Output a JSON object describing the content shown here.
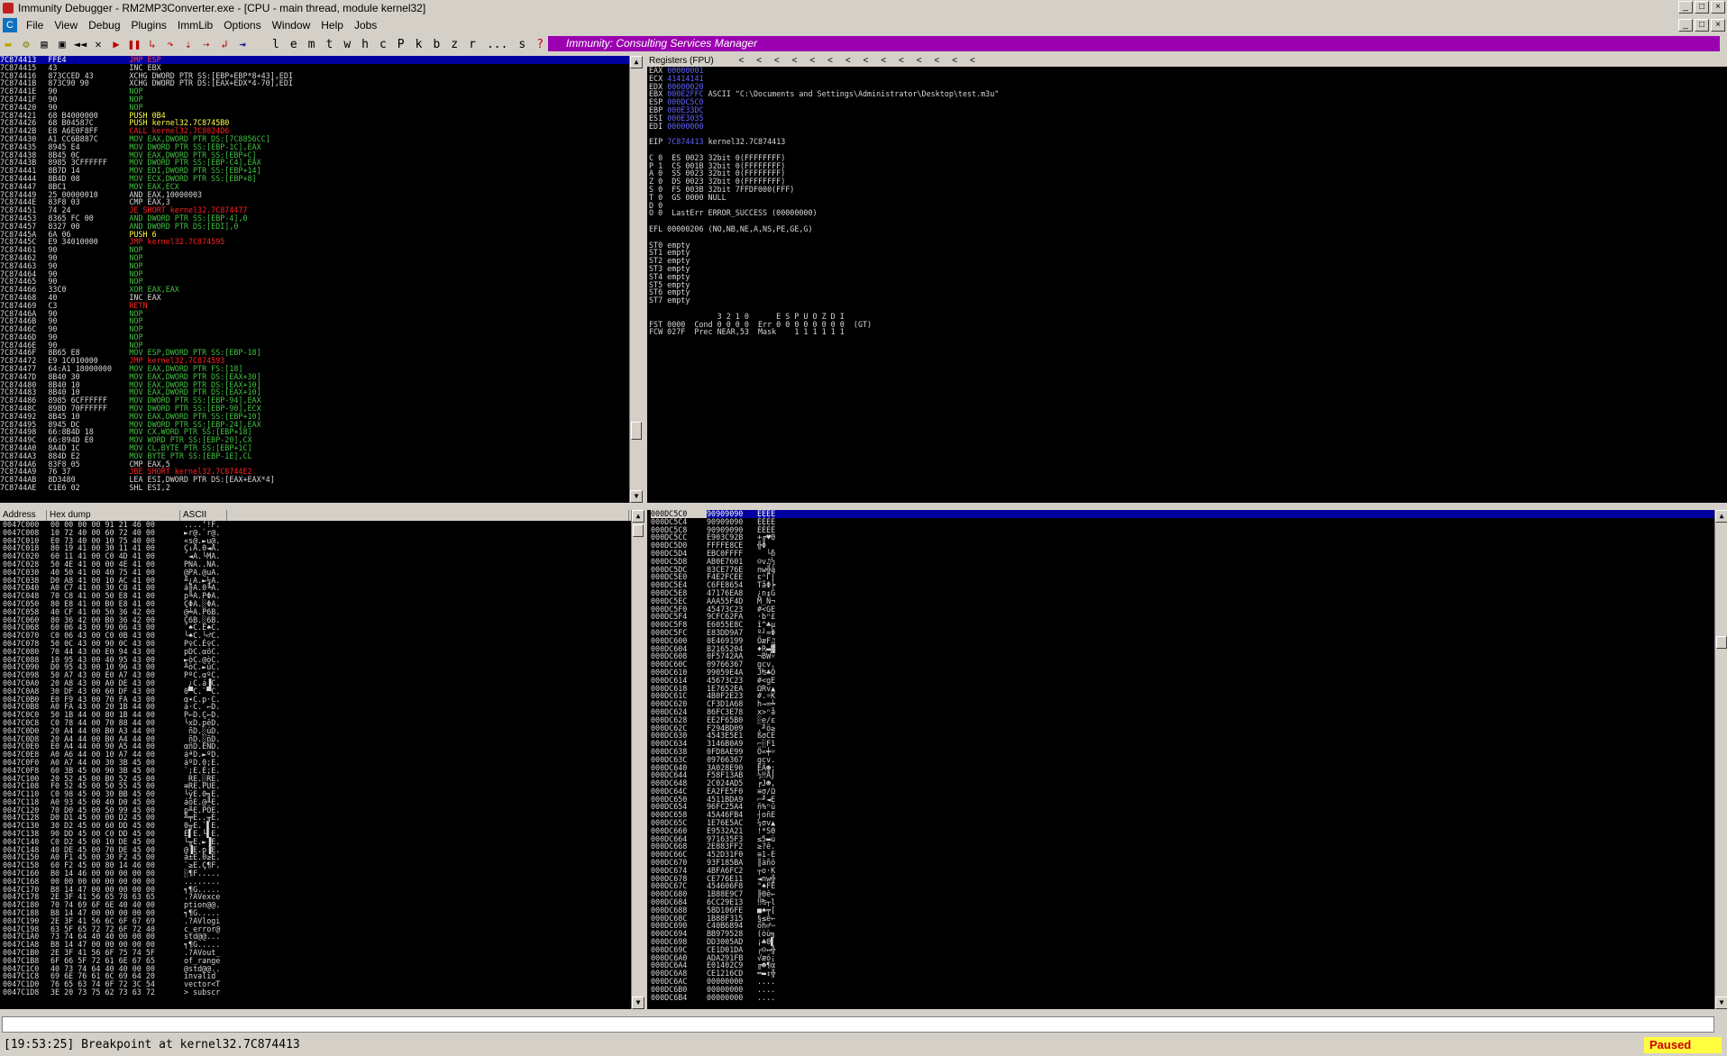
{
  "window": {
    "title": "Immunity Debugger - RM2MP3Converter.exe - [CPU - main thread, module kernel32]"
  },
  "menu": [
    "File",
    "View",
    "Debug",
    "Plugins",
    "ImmLib",
    "Options",
    "Window",
    "Help",
    "Jobs"
  ],
  "toolbar": {
    "letters": [
      "l",
      "e",
      "m",
      "t",
      "w",
      "h",
      "c",
      "P",
      "k",
      "b",
      "z",
      "r",
      "...",
      "s",
      "?"
    ],
    "banner": "Immunity: Consulting Services Manager"
  },
  "disasm": [
    {
      "a": "7C874413",
      "h": "FFE4",
      "c": "JMP ESP",
      "t": "jump",
      "sel": true
    },
    {
      "a": "7C874415",
      "h": "43",
      "c": "INC EBX",
      "t": "default"
    },
    {
      "a": "7C874416",
      "h": "873CCED 43",
      "c": "XCHG DWORD PTR SS:[EBP+EBP*8+43],EDI",
      "t": "default"
    },
    {
      "a": "7C87441B",
      "h": "873C90 90",
      "c": "XCHG DWORD PTR DS:[EAX+EDX*4-70],EDI",
      "t": "default"
    },
    {
      "a": "7C87441E",
      "h": "90",
      "c": "NOP",
      "t": "nop"
    },
    {
      "a": "7C87441F",
      "h": "90",
      "c": "NOP",
      "t": "nop"
    },
    {
      "a": "7C874420",
      "h": "90",
      "c": "NOP",
      "t": "nop"
    },
    {
      "a": "7C874421",
      "h": "68 B4000000",
      "c": "PUSH 0B4",
      "t": "push"
    },
    {
      "a": "7C874426",
      "h": "68 B04587C",
      "c": "PUSH kernel32.7C8745B0",
      "t": "push"
    },
    {
      "a": "7C87442B",
      "h": "E8 A6E0F8FF",
      "c": "CALL kernel32.7C8024D6",
      "t": "call"
    },
    {
      "a": "7C874430",
      "h": "A1 CC6B887C",
      "c": "MOV EAX,DWORD PTR DS:[7C8856CC]",
      "t": "mov"
    },
    {
      "a": "7C874435",
      "h": "8945 E4",
      "c": "MOV DWORD PTR SS:[EBP-1C],EAX",
      "t": "mov"
    },
    {
      "a": "7C874438",
      "h": "8B45 0C",
      "c": "MOV EAX,DWORD PTR SS:[EBP+C]",
      "t": "mov"
    },
    {
      "a": "7C87443B",
      "h": "8985 3CFFFFFF",
      "c": "MOV DWORD PTR SS:[EBP-C4],EAX",
      "t": "mov"
    },
    {
      "a": "7C874441",
      "h": "8B7D 14",
      "c": "MOV EDI,DWORD PTR SS:[EBP+14]",
      "t": "mov"
    },
    {
      "a": "7C874444",
      "h": "8B4D 08",
      "c": "MOV ECX,DWORD PTR SS:[EBP+8]",
      "t": "mov"
    },
    {
      "a": "7C874447",
      "h": "8BC1",
      "c": "MOV EAX,ECX",
      "t": "mov"
    },
    {
      "a": "7C874449",
      "h": "25 00000010",
      "c": "AND EAX,10000003",
      "t": "default"
    },
    {
      "a": "7C87444E",
      "h": "83F8 03",
      "c": "CMP EAX,3",
      "t": "default"
    },
    {
      "a": "7C874451",
      "h": "74 24",
      "c": "JE SHORT kernel32.7C874477",
      "t": "jump"
    },
    {
      "a": "7C874453",
      "h": "8365 FC 00",
      "c": "AND DWORD PTR SS:[EBP-4],0",
      "t": "mov"
    },
    {
      "a": "7C874457",
      "h": "8327 00",
      "c": "AND DWORD PTR DS:[EDI],0",
      "t": "mov"
    },
    {
      "a": "7C87445A",
      "h": "6A 06",
      "c": "PUSH 6",
      "t": "push"
    },
    {
      "a": "7C87445C",
      "h": "E9 34010000",
      "c": "JMP kernel32.7C874595",
      "t": "jump"
    },
    {
      "a": "7C874461",
      "h": "90",
      "c": "NOP",
      "t": "nop"
    },
    {
      "a": "7C874462",
      "h": "90",
      "c": "NOP",
      "t": "nop"
    },
    {
      "a": "7C874463",
      "h": "90",
      "c": "NOP",
      "t": "nop"
    },
    {
      "a": "7C874464",
      "h": "90",
      "c": "NOP",
      "t": "nop"
    },
    {
      "a": "7C874465",
      "h": "90",
      "c": "NOP",
      "t": "nop"
    },
    {
      "a": "7C874466",
      "h": "33C0",
      "c": "XOR EAX,EAX",
      "t": "xor"
    },
    {
      "a": "7C874468",
      "h": "40",
      "c": "INC EAX",
      "t": "default"
    },
    {
      "a": "7C874469",
      "h": "C3",
      "c": "RETN",
      "t": "jump"
    },
    {
      "a": "7C87446A",
      "h": "90",
      "c": "NOP",
      "t": "nop"
    },
    {
      "a": "7C87446B",
      "h": "90",
      "c": "NOP",
      "t": "nop"
    },
    {
      "a": "7C87446C",
      "h": "90",
      "c": "NOP",
      "t": "nop"
    },
    {
      "a": "7C87446D",
      "h": "90",
      "c": "NOP",
      "t": "nop"
    },
    {
      "a": "7C87446E",
      "h": "90",
      "c": "NOP",
      "t": "nop"
    },
    {
      "a": "7C87446F",
      "h": "8B65 E8",
      "c": "MOV ESP,DWORD PTR SS:[EBP-18]",
      "t": "mov"
    },
    {
      "a": "7C874472",
      "h": "E9 1C010000",
      "c": "JMP kernel32.7C874593",
      "t": "jump"
    },
    {
      "a": "7C874477",
      "h": "64:A1 18000000",
      "c": "MOV EAX,DWORD PTR FS:[18]",
      "t": "mov"
    },
    {
      "a": "7C87447D",
      "h": "8B40 30",
      "c": "MOV EAX,DWORD PTR DS:[EAX+30]",
      "t": "mov"
    },
    {
      "a": "7C874480",
      "h": "8B40 10",
      "c": "MOV EAX,DWORD PTR DS:[EAX+10]",
      "t": "mov"
    },
    {
      "a": "7C874483",
      "h": "8B40 10",
      "c": "MOV EAX,DWORD PTR DS:[EAX+10]",
      "t": "mov"
    },
    {
      "a": "7C874486",
      "h": "8985 6CFFFFFF",
      "c": "MOV DWORD PTR SS:[EBP-94],EAX",
      "t": "mov"
    },
    {
      "a": "7C87448C",
      "h": "898D 70FFFFFF",
      "c": "MOV DWORD PTR SS:[EBP-90],ECX",
      "t": "mov"
    },
    {
      "a": "7C874492",
      "h": "8B45 10",
      "c": "MOV EAX,DWORD PTR SS:[EBP+10]",
      "t": "mov"
    },
    {
      "a": "7C874495",
      "h": "8945 DC",
      "c": "MOV DWORD PTR SS:[EBP-24],EAX",
      "t": "mov"
    },
    {
      "a": "7C874498",
      "h": "66:8B4D 18",
      "c": "MOV CX,WORD PTR SS:[EBP+18]",
      "t": "mov"
    },
    {
      "a": "7C87449C",
      "h": "66:894D E0",
      "c": "MOV WORD PTR SS:[EBP-20],CX",
      "t": "mov"
    },
    {
      "a": "7C8744A0",
      "h": "8A4D 1C",
      "c": "MOV CL,BYTE PTR SS:[EBP+1C]",
      "t": "mov"
    },
    {
      "a": "7C8744A3",
      "h": "884D E2",
      "c": "MOV BYTE PTR SS:[EBP-1E],CL",
      "t": "mov"
    },
    {
      "a": "7C8744A6",
      "h": "83F8 05",
      "c": "CMP EAX,5",
      "t": "default"
    },
    {
      "a": "7C8744A9",
      "h": "76 37",
      "c": "JBE SHORT kernel32.7C8744E2",
      "t": "jump"
    },
    {
      "a": "7C8744AB",
      "h": "8D3480",
      "c": "LEA ESI,DWORD PTR DS:[EAX+EAX*4]",
      "t": "default"
    },
    {
      "a": "7C8744AE",
      "h": "C1E6 02",
      "c": "SHL ESI,2",
      "t": "default"
    }
  ],
  "registers": {
    "header": "Registers (FPU)",
    "gp": [
      {
        "n": "EAX",
        "v": "00000001",
        "c": ""
      },
      {
        "n": "ECX",
        "v": "41414141",
        "c": ""
      },
      {
        "n": "EDX",
        "v": "00000020",
        "c": ""
      },
      {
        "n": "EBX",
        "v": "000E2FFC",
        "c": "ASCII \"C:\\Documents and Settings\\Administrator\\Desktop\\test.m3u\""
      },
      {
        "n": "ESP",
        "v": "000DC5C0",
        "c": ""
      },
      {
        "n": "EBP",
        "v": "000E33DC",
        "c": ""
      },
      {
        "n": "ESI",
        "v": "000E3035",
        "c": ""
      },
      {
        "n": "EDI",
        "v": "00000000",
        "c": ""
      }
    ],
    "eip": {
      "n": "EIP",
      "v": "7C874413",
      "c": "kernel32.7C874413"
    },
    "flags": [
      "C 0  ES 0023 32bit 0(FFFFFFFF)",
      "P 1  CS 001B 32bit 0(FFFFFFFF)",
      "A 0  SS 0023 32bit 0(FFFFFFFF)",
      "Z 0  DS 0023 32bit 0(FFFFFFFF)",
      "S 0  FS 003B 32bit 7FFDF000(FFF)",
      "T 0  GS 0000 NULL",
      "D 0",
      "O 0  LastErr ERROR_SUCCESS (00000000)"
    ],
    "efl": "EFL 00000206 (NO,NB,NE,A,NS,PE,GE,G)",
    "fpu": [
      "ST0 empty",
      "ST1 empty",
      "ST2 empty",
      "ST3 empty",
      "ST4 empty",
      "ST5 empty",
      "ST6 empty",
      "ST7 empty"
    ],
    "fpu_hdr": "               3 2 1 0      E S P U O Z D I",
    "fst": "FST 0000  Cond 0 0 0 0  Err 0 0 0 0 0 0 0 0  (GT)",
    "fcw": "FCW 027F  Prec NEAR,53  Mask    1 1 1 1 1 1"
  },
  "dump": {
    "headers": [
      "Address",
      "Hex dump",
      "ASCII"
    ],
    "rows": [
      [
        "0047C000",
        "00 00 00 00 91 21 46 00",
        "....‘!F."
      ],
      [
        "0047C008",
        "10 72 40 00 60 72 40 00",
        "►r@.`r@."
      ],
      [
        "0047C010",
        "E0 73 40 00 10 75 40 00",
        "«s@.►u@."
      ],
      [
        "0047C018",
        "80 19 41 00 30 11 41 00",
        "Ç↓A.0◄A."
      ],
      [
        "0047C020",
        "60 11 41 00 C0 4D 41 00",
        "`◄A.└MA."
      ],
      [
        "0047C028",
        "50 4E 41 00 00 4E 41 00",
        "PNA..NA."
      ],
      [
        "0047C030",
        "40 50 41 00 40 75 41 00",
        "@PA.@uA."
      ],
      [
        "0047C038",
        "D0 A8 41 00 10 AC 41 00",
        "╨¿A.►¼A."
      ],
      [
        "0047C040",
        "A0 C7 41 00 30 C8 41 00",
        "á╟A.0╚A."
      ],
      [
        "0047C048",
        "70 C8 41 00 50 E8 41 00",
        "p╚A.PΦA."
      ],
      [
        "0047C050",
        "80 E8 41 00 B0 E8 41 00",
        "ÇΦA.░ΦA."
      ],
      [
        "0047C058",
        "40 CF 41 00 50 36 42 00",
        "@╧A.P6B."
      ],
      [
        "0047C060",
        "80 36 42 00 B0 36 42 00",
        "Ç6B.░6B."
      ],
      [
        "0047C068",
        "60 06 43 00 90 06 43 00",
        "`♠C.É♠C."
      ],
      [
        "0047C070",
        "C0 06 43 00 C0 0B 43 00",
        "└♠C.└♂C."
      ],
      [
        "0047C078",
        "50 0C 43 00 90 0C 43 00",
        "P♀C.É♀C."
      ],
      [
        "0047C080",
        "70 44 43 00 E0 94 43 00",
        "pDC.αöC."
      ],
      [
        "0047C088",
        "10 95 43 00 40 95 43 00",
        "►òC.@òC."
      ],
      [
        "0047C090",
        "D0 95 43 00 10 96 43 00",
        "╨òC.►ûC."
      ],
      [
        "0047C098",
        "50 A7 43 00 E0 A7 43 00",
        "PºC.αºC."
      ],
      [
        "0047C0A0",
        "20 A8 43 00 A0 DE 43 00",
        " ¿C.á▐C."
      ],
      [
        "0047C0A8",
        "30 DF 43 00 60 DF 43 00",
        "0▀C.`▀C."
      ],
      [
        "0047C0B0",
        "E0 F9 43 00 70 FA 43 00",
        "α∙C.p·C."
      ],
      [
        "0047C0B8",
        "A0 FA 43 00 20 1B 44 00",
        "á·C. ←D."
      ],
      [
        "0047C0C0",
        "50 1B 44 00 80 1B 44 00",
        "P←D.Ç←D."
      ],
      [
        "0047C0C8",
        "C0 78 44 00 70 88 44 00",
        "└xD.pêD."
      ],
      [
        "0047C0D0",
        "20 A4 44 00 B0 A3 44 00",
        " ñD.░úD."
      ],
      [
        "0047C0D8",
        "20 A4 44 00 B0 A4 44 00",
        " ñD.░ñD."
      ],
      [
        "0047C0E0",
        "E0 A4 44 00 90 A5 44 00",
        "αñD.ÉÑD."
      ],
      [
        "0047C0E8",
        "A0 A6 44 00 10 A7 44 00",
        "áªD.►ºD."
      ],
      [
        "0047C0F0",
        "A0 A7 44 00 30 3B 45 00",
        "áºD.0;E."
      ],
      [
        "0047C0F8",
        "60 3B 45 00 90 3B 45 00",
        "`;E.É;E."
      ],
      [
        "0047C100",
        "20 52 45 00 B0 52 45 00",
        " RE.░RE."
      ],
      [
        "0047C108",
        "F0 52 45 00 50 55 45 00",
        "≡RE.PUE."
      ],
      [
        "0047C110",
        "C0 98 45 00 30 BB 45 00",
        "└ÿE.0╗E."
      ],
      [
        "0047C118",
        "A0 93 45 00 40 D0 45 00",
        "áôE.@╨E."
      ],
      [
        "0047C120",
        "70 D0 45 00 50 99 45 00",
        "p╨E.PÖE."
      ],
      [
        "0047C128",
        "D0 D1 45 00 00 D2 45 00",
        "╨╤E..╥E."
      ],
      [
        "0047C130",
        "30 D2 45 00 60 DD 45 00",
        "0╥E.`▌E."
      ],
      [
        "0047C138",
        "90 DD 45 00 C0 DD 45 00",
        "É▌E.└▌E."
      ],
      [
        "0047C140",
        "C0 D2 45 00 10 DE 45 00",
        "└╥E.►▐E."
      ],
      [
        "0047C148",
        "40 DE 45 00 70 DE 45 00",
        "@▐E.p▐E."
      ],
      [
        "0047C150",
        "A0 F1 45 00 30 F2 45 00",
        "á±E.0≥E."
      ],
      [
        "0047C158",
        "60 F2 45 00 80 14 46 00",
        "`≥E.Ç¶F."
      ],
      [
        "0047C160",
        "B0 14 46 00 00 00 00 00",
        "░¶F....."
      ],
      [
        "0047C168",
        "00 00 00 00 00 00 00 00",
        "........"
      ],
      [
        "0047C170",
        "B8 14 47 00 00 00 00 00",
        "╕¶G....."
      ],
      [
        "0047C178",
        "2E 3F 41 56 65 78 63 65",
        ".?AVexce"
      ],
      [
        "0047C180",
        "70 74 69 6F 6E 40 40 00",
        "ption@@."
      ],
      [
        "0047C188",
        "B8 14 47 00 00 00 00 00",
        "╕¶G....."
      ],
      [
        "0047C190",
        "2E 3F 41 56 6C 6F 67 69",
        ".?AVlogi"
      ],
      [
        "0047C198",
        "63 5F 65 72 72 6F 72 40",
        "c_error@"
      ],
      [
        "0047C1A0",
        "73 74 64 40 40 00 00 00",
        "std@@..."
      ],
      [
        "0047C1A8",
        "B8 14 47 00 00 00 00 00",
        "╕¶G....."
      ],
      [
        "0047C1B0",
        "2E 3F 41 56 6F 75 74 5F",
        ".?AVout_"
      ],
      [
        "0047C1B8",
        "6F 66 5F 72 61 6E 67 65",
        "of_range"
      ],
      [
        "0047C1C0",
        "40 73 74 64 40 40 00 00",
        "@std@@.."
      ],
      [
        "0047C1C8",
        "69 6E 76 61 6C 69 64 20",
        "invalid "
      ],
      [
        "0047C1D0",
        "76 65 63 74 6F 72 3C 54",
        "vector<T"
      ],
      [
        "0047C1D8",
        "3E 20 73 75 62 73 63 72",
        "> subscr"
      ]
    ]
  },
  "stack": [
    [
      "000DC5C0",
      "90909090",
      "ÉÉÉÉ",
      true
    ],
    [
      "000DC5C4",
      "90909090",
      "ÉÉÉÉ",
      false
    ],
    [
      "000DC5C8",
      "90909090",
      "ÉÉÉÉ",
      false
    ],
    [
      "000DC5CC",
      "E903C92B",
      "+╔♥Θ",
      false
    ],
    [
      "000DC5D0",
      "FFFFE8CE",
      "╬Φ  ",
      false
    ],
    [
      "000DC5D4",
      "EBC0FFFF",
      "  └δ",
      false
    ],
    [
      "000DC5D8",
      "AB0E7601",
      "☺v♫½",
      false
    ],
    [
      "000DC5DC",
      "83CE776E",
      "nw╬â",
      false
    ],
    [
      "000DC5E0",
      "F4E2FCEE",
      "εⁿΓ⌠",
      false
    ],
    [
      "000DC5E4",
      "C6FE8654",
      "TåΦ╞",
      false
    ],
    [
      "000DC5E8",
      "47176EA8",
      "¿n↨G",
      false
    ],
    [
      "000DC5EC",
      "AAA55F4D",
      "M_Ñ¬",
      false
    ],
    [
      "000DC5F0",
      "45473C23",
      "#<GE",
      false
    ],
    [
      "000DC5F4",
      "9CFC62FA",
      "·bⁿ£",
      false
    ],
    [
      "000DC5F8",
      "E6055E8C",
      "î^♣µ",
      false
    ],
    [
      "000DC5FC",
      "E83DD9A7",
      "º┘=Φ",
      false
    ],
    [
      "000DC600",
      "0E469199",
      "ÖæF♫",
      false
    ],
    [
      "000DC604",
      "B2165204",
      "♦R▬▓",
      false
    ],
    [
      "000DC608",
      "0F5742AA",
      "¬BW☼",
      false
    ],
    [
      "000DC60C",
      "09766367",
      "gcv.",
      false
    ],
    [
      "000DC610",
      "99059E4A",
      "J₧♣Ö",
      false
    ],
    [
      "000DC614",
      "45673C23",
      "#<gE",
      false
    ],
    [
      "000DC618",
      "1E7652EA",
      "ΩRv▲",
      false
    ],
    [
      "000DC61C",
      "4B0F2E23",
      "#.☼K",
      false
    ],
    [
      "000DC620",
      "CF3D1A68",
      "h→=╧",
      false
    ],
    [
      "000DC624",
      "86FC3E78",
      "x>ⁿå",
      false
    ],
    [
      "000DC628",
      "EE2F65B0",
      "░e/ε",
      false
    ],
    [
      "000DC62C",
      "F294BD09",
      ".╜ö≥",
      false
    ],
    [
      "000DC630",
      "4543E5E1",
      "ßσCE",
      false
    ],
    [
      "000DC634",
      "3146B0A9",
      "⌐░F1",
      false
    ],
    [
      "000DC638",
      "0FD8AE99",
      "Ö«╪☼",
      false
    ],
    [
      "000DC63C",
      "09766367",
      "gcv.",
      false
    ],
    [
      "000DC640",
      "3A028E90",
      "ÉÄ☻:",
      false
    ],
    [
      "000DC644",
      "F58F13AB",
      "½‼Å⌡",
      false
    ],
    [
      "000DC648",
      "2C024AD5",
      "╒J☻,",
      false
    ],
    [
      "000DC64C",
      "EA2FE5F0",
      "≡σ/Ω",
      false
    ],
    [
      "000DC650",
      "4511BDA9",
      "⌐╜◄E",
      false
    ],
    [
      "000DC654",
      "96FC25A4",
      "ñ%ⁿû",
      false
    ],
    [
      "000DC658",
      "45A46FB4",
      "┤oñE",
      false
    ],
    [
      "000DC65C",
      "1E76E5AC",
      "¼σv▲",
      false
    ],
    [
      "000DC660",
      "E9532A21",
      "!*SΘ",
      false
    ],
    [
      "000DC664",
      "971635F3",
      "≤5▬ù",
      false
    ],
    [
      "000DC668",
      "2E883FF2",
      "≥?ê.",
      false
    ],
    [
      "000DC66C",
      "452D31F0",
      "≡1-E",
      false
    ],
    [
      "000DC670",
      "93F185BA",
      "║àñô",
      false
    ],
    [
      "000DC674",
      "4BFA6FC2",
      "┬o·K",
      false
    ],
    [
      "000DC678",
      "CE776E11",
      "◄nw╬",
      false
    ],
    [
      "000DC67C",
      "454606F8",
      "°♠FE",
      false
    ],
    [
      "000DC680",
      "1B88E9C7",
      "╟Θê←",
      false
    ],
    [
      "000DC684",
      "6CC29E13",
      "‼₧┬l",
      false
    ],
    [
      "000DC688",
      "5BD106FE",
      "■♠╤[",
      false
    ],
    [
      "000DC68C",
      "1B88F315",
      "§≤ê←",
      false
    ],
    [
      "000DC690",
      "C40B6894",
      "öh♂─",
      false
    ],
    [
      "000DC694",
      "BB979528",
      "(òù╗",
      false
    ],
    [
      "000DC698",
      "DD3005AD",
      "¡♣0▌",
      false
    ],
    [
      "000DC69C",
      "CE1D01DA",
      "┌☺↔╬",
      false
    ],
    [
      "000DC6A0",
      "ADA291FB",
      "√æó¡",
      false
    ],
    [
      "000DC6A4",
      "E01402C9",
      "╔☻¶α",
      false
    ],
    [
      "000DC6A8",
      "CE1216CD",
      "═▬↕╬",
      false
    ],
    [
      "000DC6AC",
      "00000000",
      "....",
      false
    ],
    [
      "000DC6B0",
      "00000000",
      "....",
      false
    ],
    [
      "000DC6B4",
      "00000000",
      "....",
      false
    ]
  ],
  "status": {
    "message": "[19:53:25] Breakpoint at kernel32.7C874413",
    "state": "Paused"
  }
}
